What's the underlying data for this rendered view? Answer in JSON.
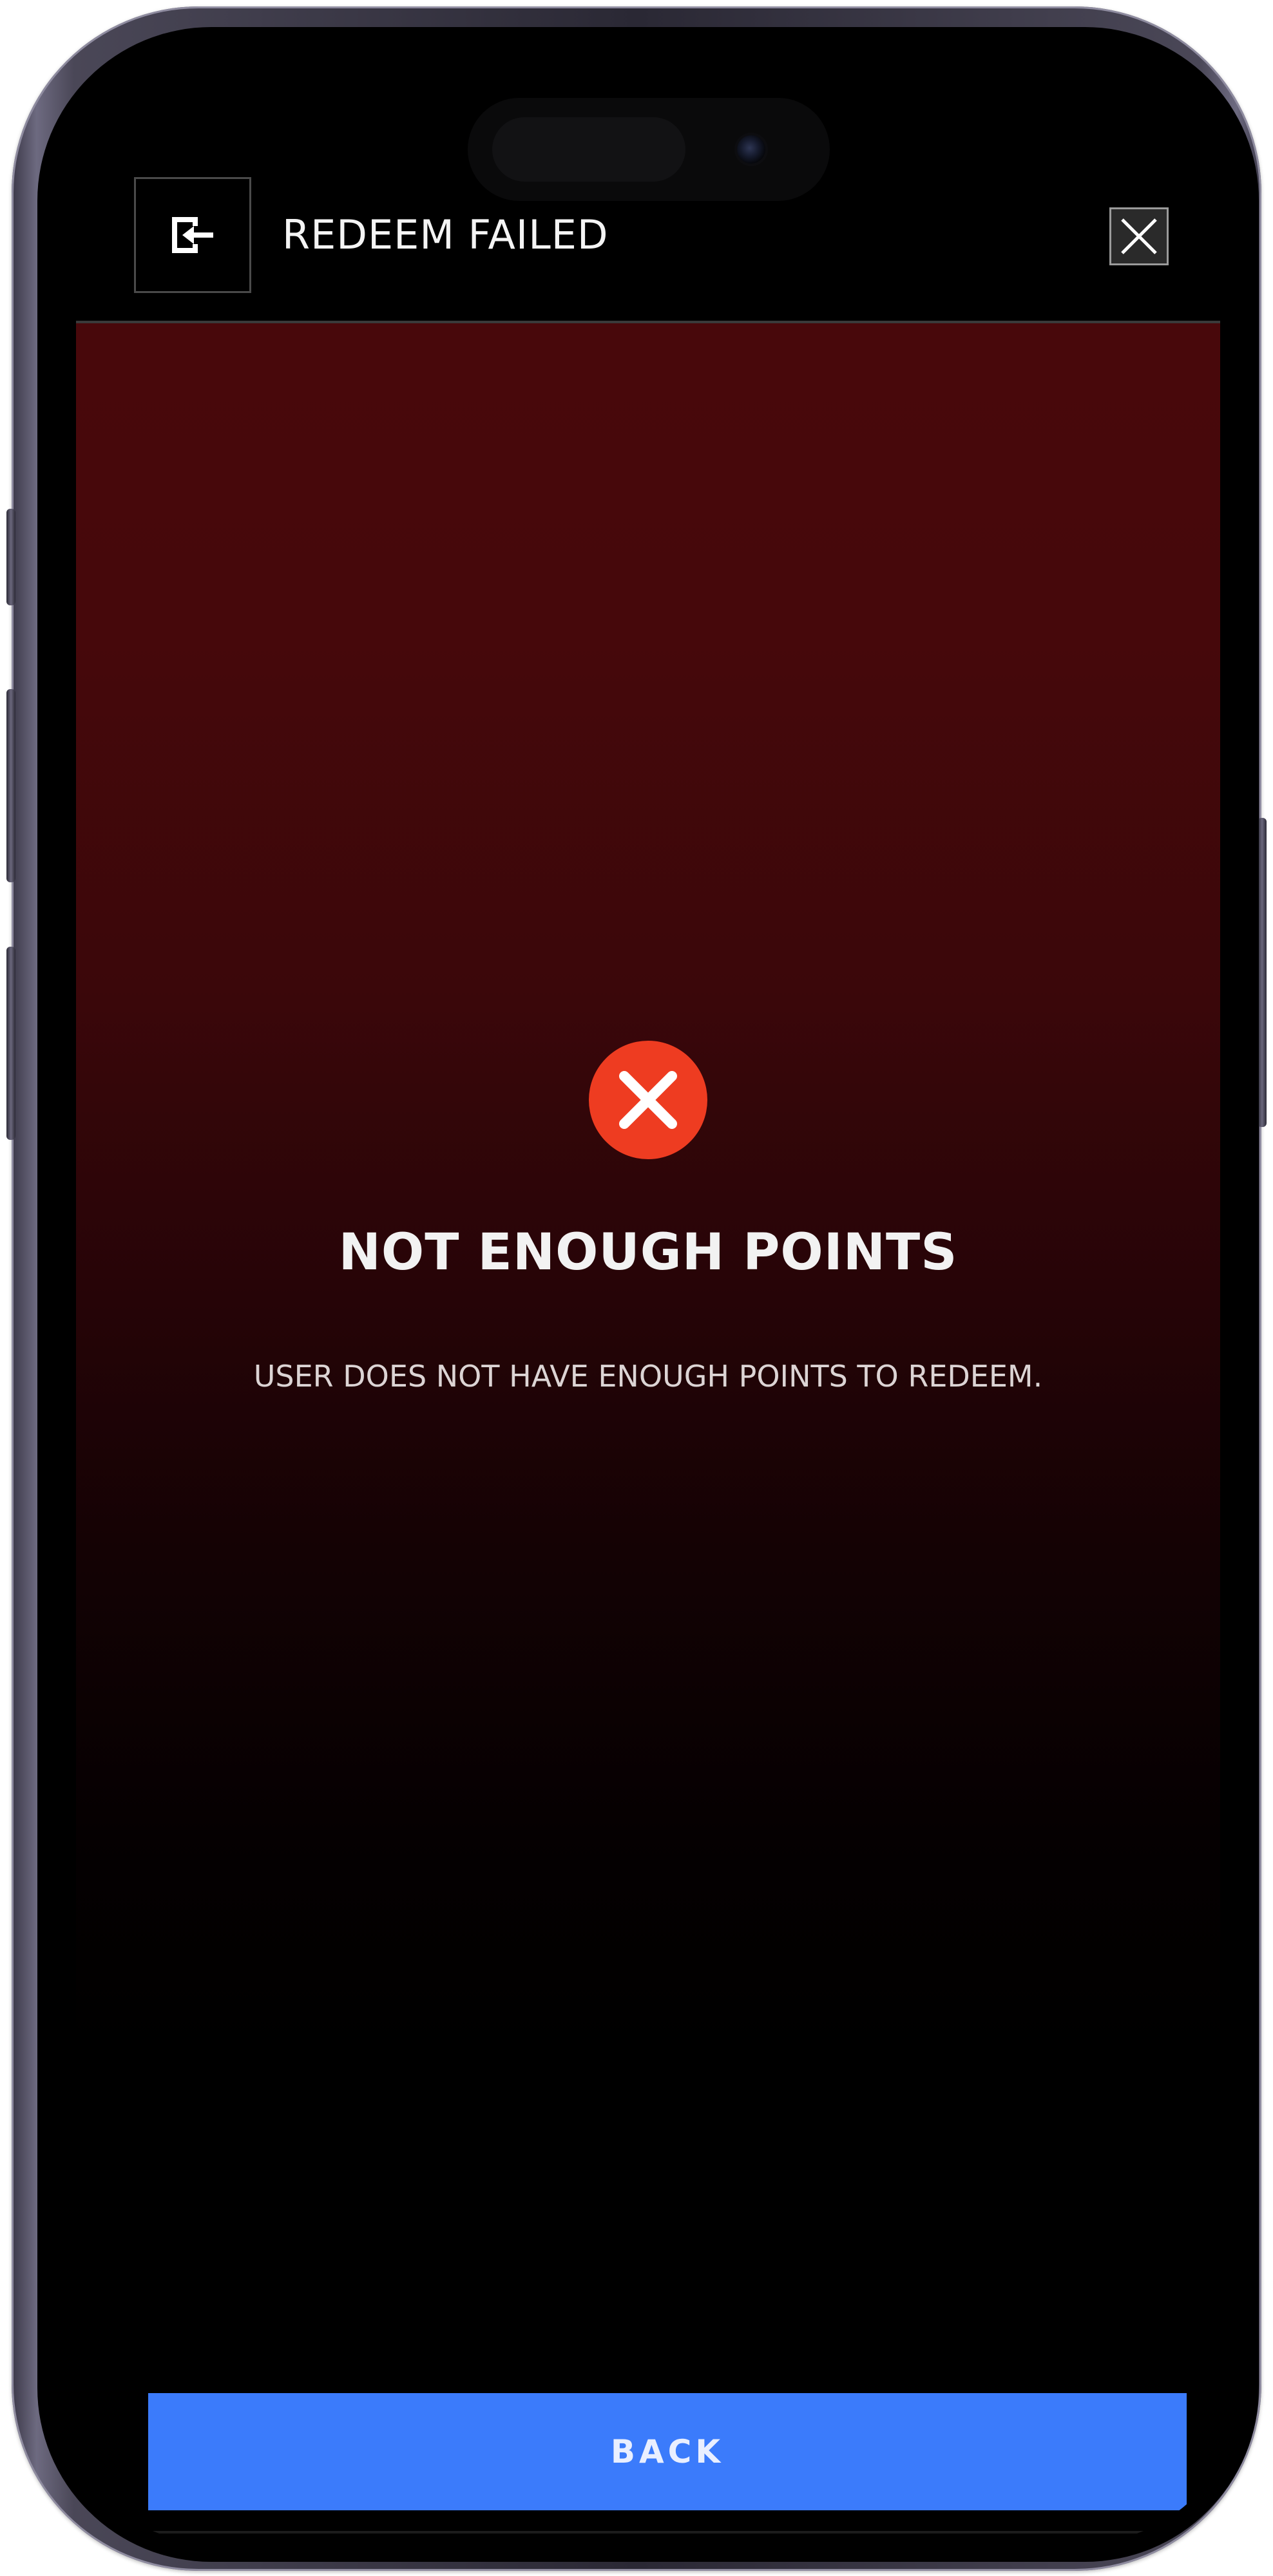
{
  "header": {
    "title": "REDEEM FAILED",
    "left_icon": "exit-arrow-icon",
    "close_icon": "close-icon"
  },
  "result": {
    "status_icon": "error-x-icon",
    "title": "NOT ENOUGH POINTS",
    "message": "USER DOES NOT HAVE ENOUGH POINTS TO REDEEM."
  },
  "actions": {
    "back_label": "BACK"
  },
  "colors": {
    "background_top": "#48080b",
    "background_bottom": "#000000",
    "error_red": "#ee3c21",
    "primary_button": "#3b7bfb",
    "text": "#f2f2f2"
  }
}
